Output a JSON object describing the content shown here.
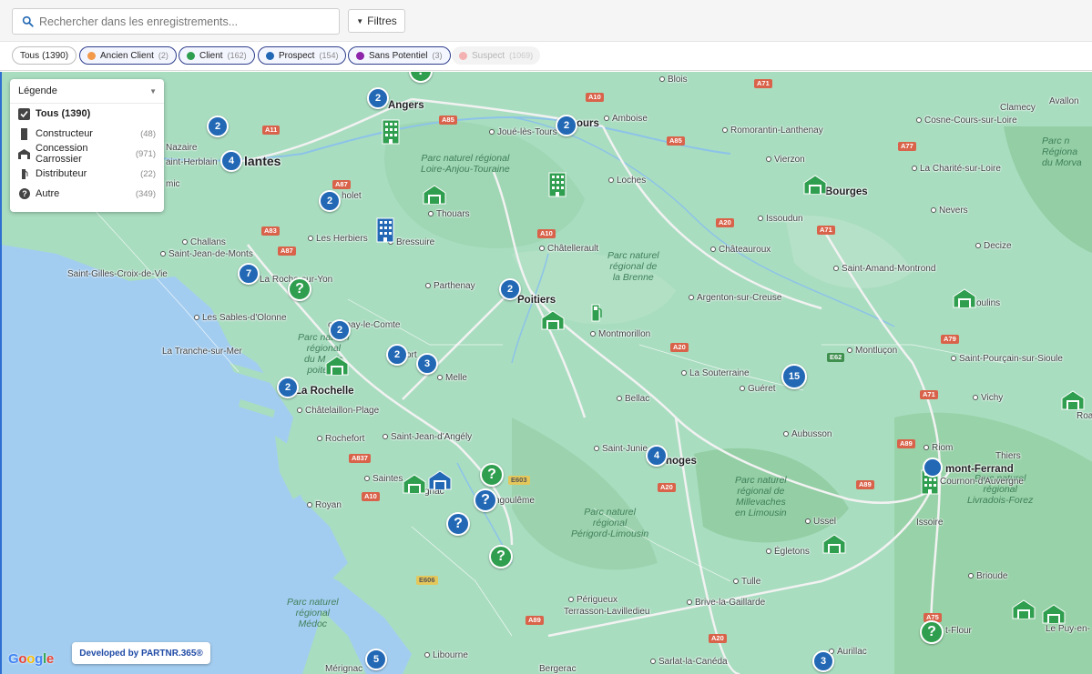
{
  "search": {
    "placeholder": "Rechercher dans les enregistrements..."
  },
  "toolbar": {
    "filters_label": "Filtres"
  },
  "chips": [
    {
      "label": "Tous",
      "count": "(1390)",
      "color": ""
    },
    {
      "label": "Ancien Client",
      "count": "(2)",
      "color": "#f2994a"
    },
    {
      "label": "Client",
      "count": "(162)",
      "color": "#2f9e4f"
    },
    {
      "label": "Prospect",
      "count": "(154)",
      "color": "#2268b5"
    },
    {
      "label": "Sans Potentiel",
      "count": "(3)",
      "color": "#8e24aa"
    },
    {
      "label": "Suspect",
      "count": "(1069)",
      "color": "#f4b1b1"
    }
  ],
  "legend": {
    "title": "Légende",
    "items": [
      {
        "label": "Tous (1390)",
        "count": "",
        "icon": "checkbox-icon"
      },
      {
        "label": "Constructeur",
        "count": "(48)",
        "icon": "building-icon"
      },
      {
        "label": "Concession Carrossier",
        "count": "(971)",
        "icon": "warehouse-icon"
      },
      {
        "label": "Distributeur",
        "count": "(22)",
        "icon": "fuel-pump-icon"
      },
      {
        "label": "Autre",
        "count": "(349)",
        "icon": "question-icon"
      }
    ]
  },
  "map": {
    "labels": {
      "angers": "Angers",
      "blois": "Blois",
      "tours": "ours",
      "amboise": "Amboise",
      "joue": "Joué-lès-Tours",
      "romorantin": "Romorantin-Lanthenay",
      "cosne": "Cosne-Cours-sur-Loire",
      "clamecy": "Clamecy",
      "avallon": "Avallon",
      "nantes": "lantes",
      "herblain": "aint-Herblain",
      "nazaire": "Nazaire",
      "mic": "mic",
      "cholet": "holet",
      "thouars": "Thouars",
      "loches": "Loches",
      "vierzon": "Vierzon",
      "bourges": "Bourges",
      "charite": "La Charité-sur-Loire",
      "nevers": "Nevers",
      "challans": "Challans",
      "jeanmonts": "Saint-Jean-de-Monts",
      "herbiers": "Les Herbiers",
      "bressuire": "Bressuire",
      "issoudun": "Issoudun",
      "chatellerault": "Châtellerault",
      "chateauroux": "Châteauroux",
      "decize": "Decize",
      "gilles": "Saint-Gilles-Croix-de-Vie",
      "rochesuryon": "La Roche-sur-Yon",
      "parthenay": "Parthenay",
      "poitiers": "Poitiers",
      "argenton": "Argenton-sur-Creuse",
      "amand": "Saint-Amand-Montrond",
      "moulins": "oulins",
      "sables": "Les Sables-d'Olonne",
      "fontenay": "ontenay-le-Comte",
      "montmorillon": "Montmorillon",
      "tranche": "La Tranche-sur-Mer",
      "niort": "ort",
      "melle": "Melle",
      "souterraine": "La Souterraine",
      "gueret": "Guéret",
      "montlucon": "Montluçon",
      "pourcain": "Saint-Pourçain-sur-Sioule",
      "rochelle": "La Rochelle",
      "chatelaillon": "Châtelaillon-Plage",
      "bellac": "Bellac",
      "vichy": "Vichy",
      "roa": "Roa",
      "angely": "Saint-Jean-d'Angély",
      "rochefort": "Rochefort",
      "aubusson": "Aubusson",
      "riom": "Riom",
      "junien": "Saint-Junie",
      "limoges": "noges",
      "thiers": "Thiers",
      "clermont": "mont-Ferrand",
      "cournon": "Cournon-d'Auvergne",
      "saintes": "Saintes",
      "cognac": "gnac",
      "angouleme": "ngoulême",
      "royan": "Royan",
      "ussel": "Ussel",
      "issoire": "Issoire",
      "egletons": "Égletons",
      "tulle": "Tulle",
      "brioude": "Brioude",
      "perigueux": "Périgueux",
      "terrasson": "Terrasson-Lavilledieu",
      "brive": "Brive-la-Gaillarde",
      "flour": "t-Flour",
      "puy": "Le Puy-en-",
      "libourne": "Libourne",
      "sarlat": "Sarlat-la-Canéda",
      "aurillac": "Aurillac",
      "bergerac": "Bergerac",
      "merignac": "Mérignac"
    },
    "parks": {
      "loire": "Parc naturel régional\nLoire-Anjou-Touraine",
      "brenne": "Parc naturel\nrégional de\nla Brenne",
      "poitevin": "Parc naturel\nrégional\ndu M    is\npoitevin",
      "millevaches": "Parc naturel\nrégional de\nMillevaches\nen Limousin",
      "perigord": "Parc naturel\nrégional\nPérigord-Limousin",
      "livradois": "Parc naturel\nrégional\nLivradois-Forez",
      "medoc": "Parc naturel\nrégional\nMédoc",
      "morvan": "Parc n\nRégiona\ndu Morva"
    },
    "roads": [
      "A10",
      "A71",
      "A11",
      "A85",
      "A85",
      "A77",
      "A87",
      "A20",
      "A71",
      "A83",
      "A87",
      "A10",
      "E62",
      "A79",
      "A20",
      "A71",
      "A837",
      "A10",
      "E603",
      "A89",
      "A20",
      "E606",
      "A89",
      "A89",
      "A75",
      "A20"
    ],
    "clusters": [
      "2",
      "2",
      "2",
      "4",
      "2",
      "7",
      "2",
      "2",
      "2",
      "3",
      "2",
      "15",
      "4",
      "5",
      "3"
    ]
  },
  "footer": {
    "google": [
      "G",
      "o",
      "o",
      "g",
      "l",
      "e"
    ],
    "developed_by": "Developed by PARTNR.365®"
  },
  "colors": {
    "prospect": "#2268b5",
    "client": "#2f9e4f",
    "water": "#a3cdf0",
    "land": "#a9ddc0"
  }
}
